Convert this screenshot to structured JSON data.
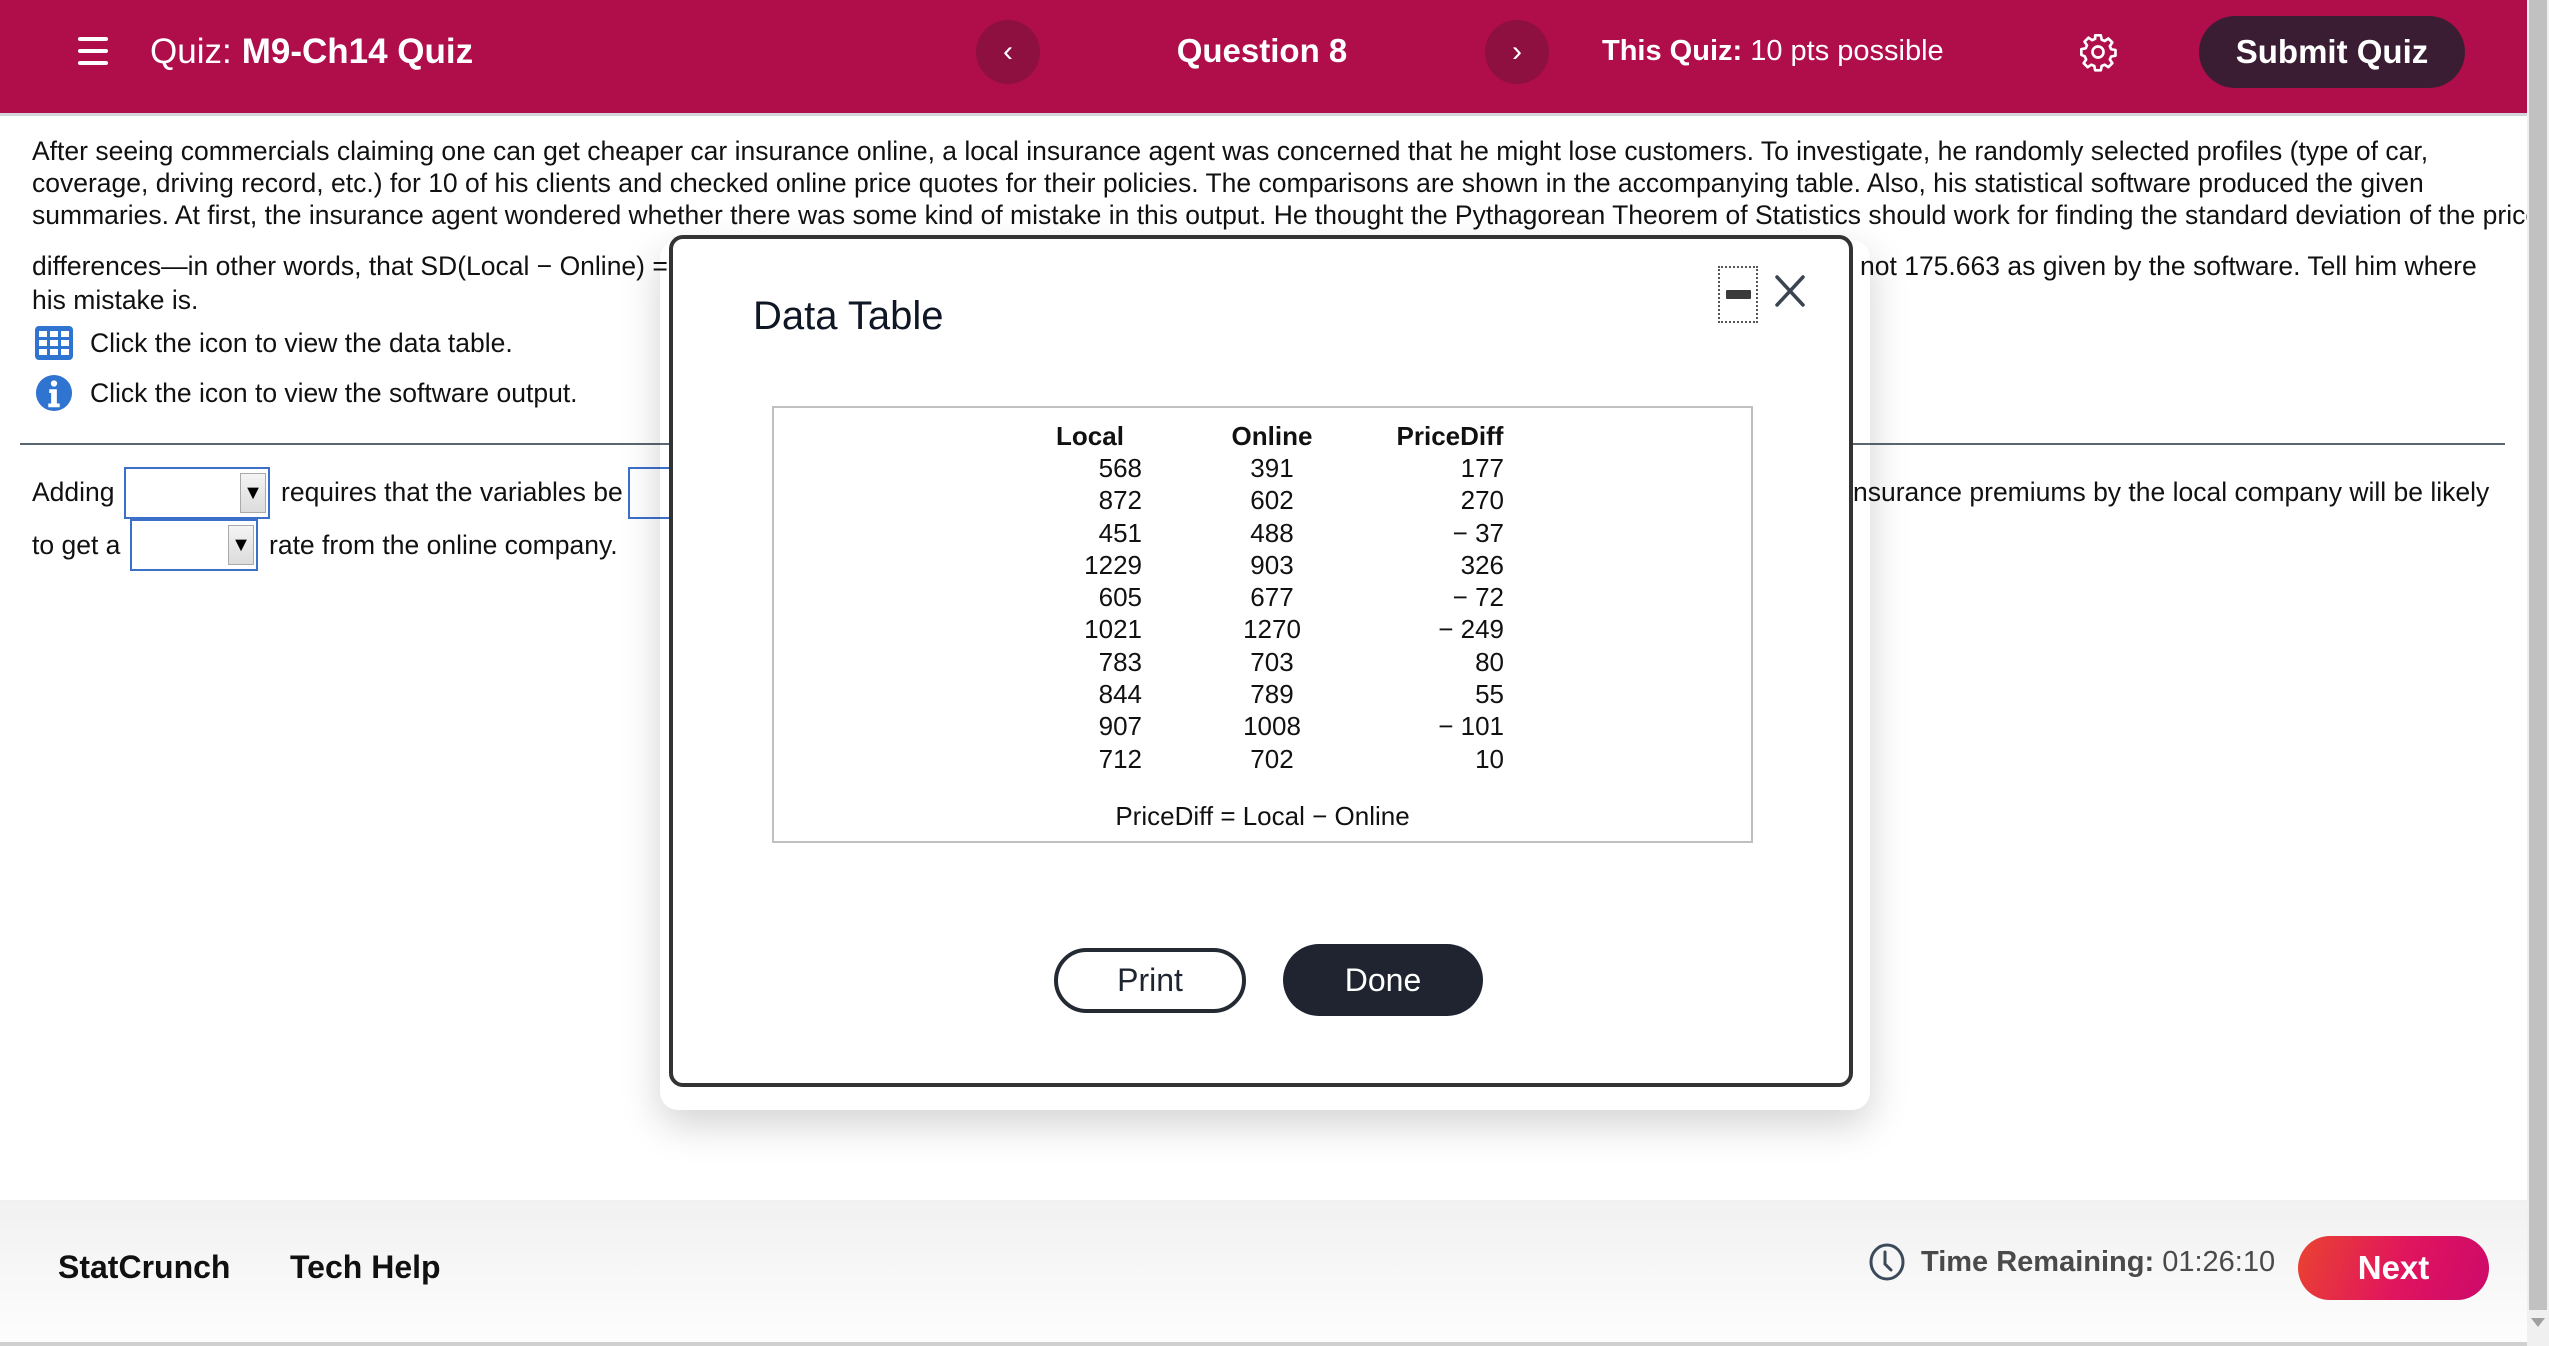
{
  "header": {
    "quiz_prefix": "Quiz:",
    "quiz_title": "M9-Ch14 Quiz",
    "prev_icon": "‹",
    "next_icon": "›",
    "question_label": "Question 8",
    "points_label": "This Quiz:",
    "points_value": "10 pts possible",
    "submit_label": "Submit Quiz",
    "brand_color": "#b00d4b"
  },
  "question": {
    "lines": [
      "After seeing commercials claiming one can get cheaper car insurance online, a local insurance agent was concerned that he might lose customers. To investigate, he randomly selected profiles (type of car,",
      "coverage, driving record, etc.) for 10 of his clients and checked online price quotes for their policies. The comparisons are shown in the accompanying table. Also, his statistical software produced the given",
      "summaries. At first, the insurance agent wondered whether there was some kind of mistake in this output. He thought the Pythagorean Theorem of Statistics should work for finding the standard deviation of the price"
    ],
    "line4_left": "differences—in other words, that SD(Local − Online) = ",
    "line4_right": "not 175.663 as given by the software. Tell him where",
    "line5": "his mistake is.",
    "data_table_link": "Click the icon to view the data table.",
    "software_output_link": "Click the icon to view the software output."
  },
  "answer": {
    "row1_prefix": "Adding",
    "row1_middle": "requires that the variables be",
    "row1_suffix": "nsurance premiums by the local company will be likely",
    "row2_prefix": "to get a",
    "row2_suffix": "rate from the online company.",
    "dropdown1_value": "",
    "dropdown2_value": "",
    "dropdown3_value": "",
    "dropdown_arrow": "▼"
  },
  "modal": {
    "title": "Data Table",
    "columns": [
      "Local",
      "Online",
      "PriceDiff"
    ],
    "rows": [
      [
        "568",
        "391",
        "177"
      ],
      [
        "872",
        "602",
        "270"
      ],
      [
        "451",
        "488",
        "− 37"
      ],
      [
        "1229",
        "903",
        "326"
      ],
      [
        "605",
        "677",
        "− 72"
      ],
      [
        "1021",
        "1270",
        "− 249"
      ],
      [
        "783",
        "703",
        "80"
      ],
      [
        "844",
        "789",
        "55"
      ],
      [
        "907",
        "1008",
        "− 101"
      ],
      [
        "712",
        "702",
        "10"
      ]
    ],
    "footnote": "PriceDiff = Local − Online",
    "print_label": "Print",
    "done_label": "Done"
  },
  "footer": {
    "statcrunch_label": "StatCrunch",
    "techhelp_label": "Tech Help",
    "time_label": "Time Remaining:",
    "time_value": "01:26:10",
    "next_label": "Next"
  }
}
